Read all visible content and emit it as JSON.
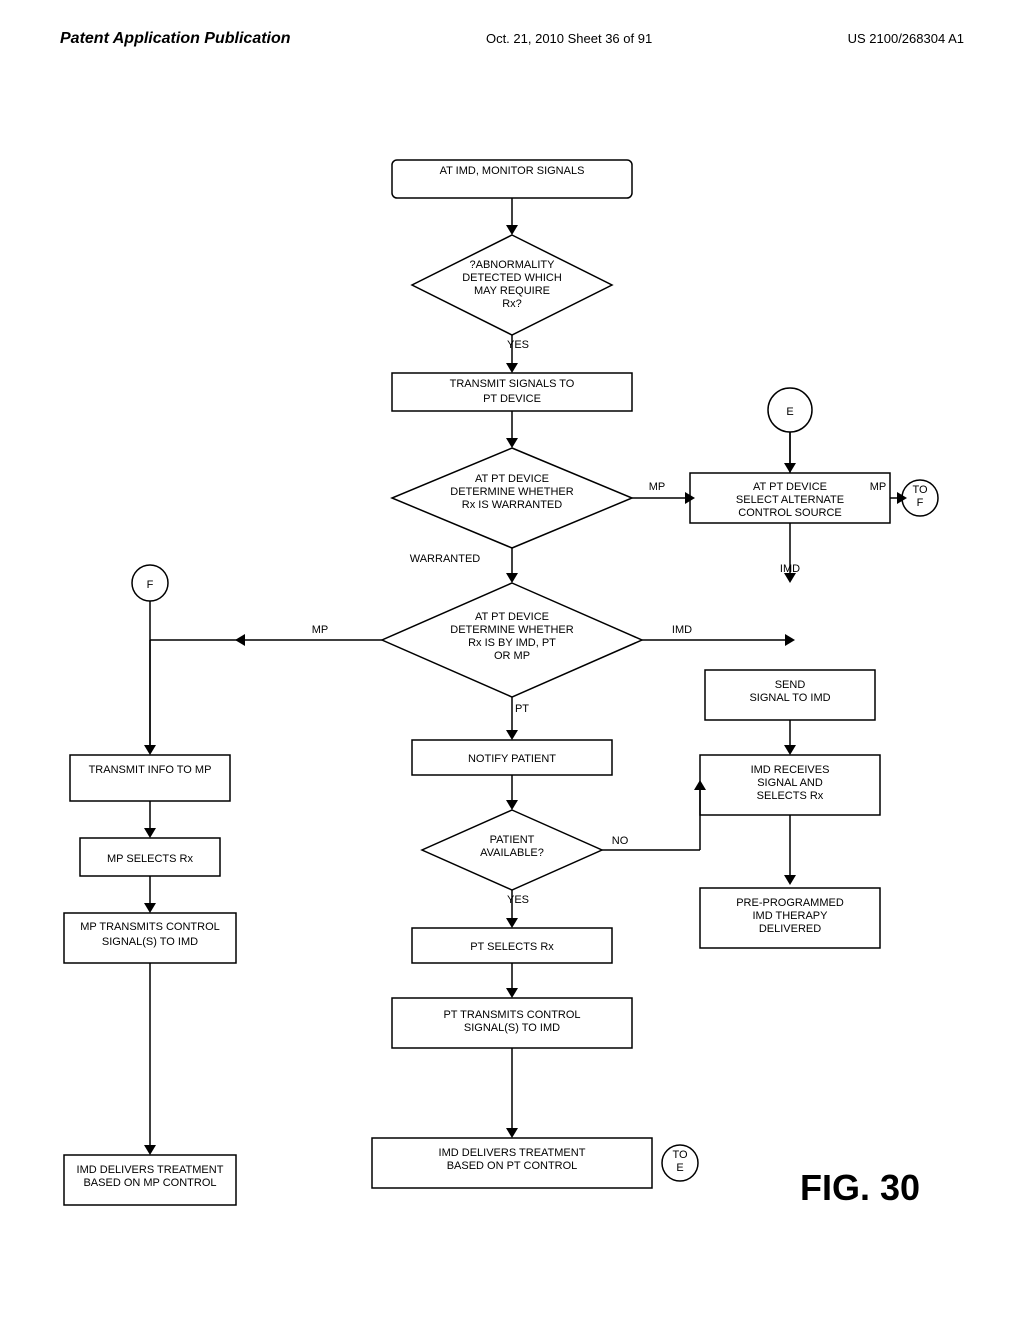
{
  "header": {
    "left": "Patent Application Publication",
    "center": "Oct. 21, 2010  Sheet 36 of 91",
    "right": "US 2100/268304 A1"
  },
  "figure": {
    "label": "FIG. 30"
  },
  "nodes": {
    "monitor": "AT IMD, MONITOR SIGNALS",
    "abnormality": "?ABNORMALITY\nDETECTED WHICH\nMAY REQUIRE\nRx?",
    "transmit_signals": "TRANSMIT SIGNALS TO\nPT DEVICE",
    "determine_warranted": "AT PT DEVICE\nDETERMINE WHETHER\nRx IS WARRANTED",
    "select_alternate": "AT PT DEVICE\nSELECT ALTERNATE\nCONTROL SOURCE",
    "determine_imd_mp": "AT PT DEVICE\nDETERMINE WHETHER\nRx IS BY IMD, PT\nOR MP",
    "notify_patient": "NOTIFY PATIENT",
    "transmit_info_mp": "TRANSMIT INFO TO MP",
    "mp_selects": "MP SELECTS Rx",
    "send_signal_imd": "SEND\nSIGNAL TO IMD",
    "patient_available": "PATIENT\nAVAILABLE?",
    "pt_selects": "PT SELECTS Rx",
    "imd_receives": "IMD RECEIVES\nSIGNAL AND\nSELECTS Rx",
    "mp_transmits": "MP TRANSMITS CONTROL\nSIGNAL(S) TO IMD",
    "pt_transmits": "PT TRANSMITS CONTROL\nSIGNAL(S) TO IMD",
    "preprogrammed": "PRE-PROGRAMMED\nIMD THERAPY\nDELIVERED",
    "imd_delivers_mp": "IMD DELIVERS TREATMENT\nBASED ON MP CONTROL",
    "imd_delivers_pt": "IMD DELIVERS TREATMENT\nBASED ON PT CONTROL"
  }
}
